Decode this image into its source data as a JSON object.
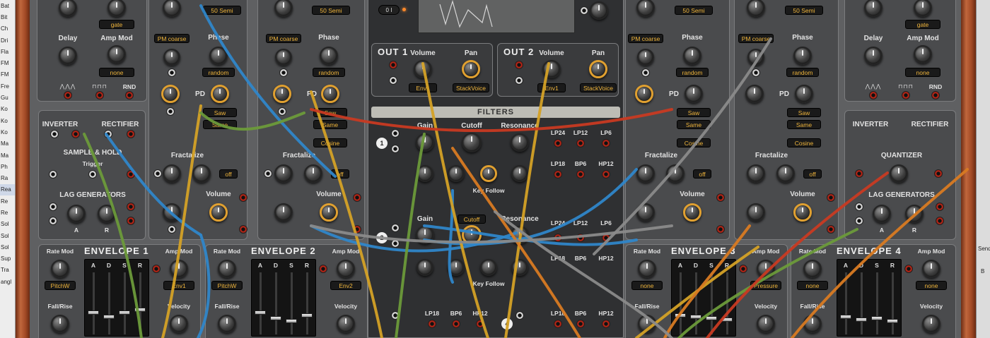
{
  "browser": {
    "items": [
      "Bat",
      "Bit",
      "Ch",
      "Dri",
      "Fla",
      "FM",
      "FM",
      "Fre",
      "Gu",
      "Ko",
      "Ko",
      "Ko",
      "Ma",
      "Ma",
      "Ph",
      "Ra",
      "Rea",
      "Re",
      "Re",
      "Sol",
      "Sol",
      "Sol",
      "Sup",
      "Tra",
      "angl"
    ],
    "selected_index": 16
  },
  "right_strip": {
    "top_text": "Send",
    "letter": "B"
  },
  "colors": {
    "rack": "#5f6062",
    "wood": "#a24a25",
    "accent": "#f0b53b",
    "cable_blue": "#2f86c9",
    "cable_yellow": "#d4a126",
    "cable_green": "#6b9a3a",
    "cable_orange": "#d87a22",
    "cable_red": "#c83a22",
    "cable_gray": "#8a8a8a"
  },
  "oscs": {
    "semi_display": "50 Semi",
    "pm_coarse": "PM coarse",
    "phase": "Phase",
    "random": "random",
    "pd": "PD",
    "saw": "Saw",
    "same": "Same",
    "cosine": "Cosine",
    "fractalize": "Fractalize",
    "off": "off",
    "volume": "Volume"
  },
  "lfo": {
    "delay": "Delay",
    "amp_mod": "Amp Mod",
    "gate": "gate",
    "none": "none",
    "rnd": "RND"
  },
  "util_left": {
    "inverter": "INVERTER",
    "rectifier": "RECTIFIER",
    "sample_hold": "SAMPLE & HOLD",
    "trigger": "Trigger",
    "lag_generators": "LAG GENERATORS",
    "a": "A",
    "r": "R"
  },
  "util_right": {
    "inverter": "INVERTER",
    "rectifier": "RECTIFIER",
    "quantizer": "QUANTIZER",
    "lag_generators": "LAG GENERATORS",
    "a": "A",
    "r": "R"
  },
  "center": {
    "toggle": "0 I",
    "out1": {
      "title": "OUT 1",
      "volume": "Volume",
      "pan": "Pan",
      "vol_src": "Env1",
      "pan_src": "StackVoice"
    },
    "out2": {
      "title": "OUT 2",
      "volume": "Volume",
      "pan": "Pan",
      "vol_src": "Env1",
      "pan_src": "StackVoice"
    },
    "filters": {
      "title": "FILTERS",
      "gain": "Gain",
      "cutoff": "Cutoff",
      "resonance": "Resonance",
      "key_follow": "Key Follow",
      "cutoff_display": "Cutoff",
      "lp24": "LP24",
      "lp12": "LP12",
      "lp6": "LP6",
      "lp18": "LP18",
      "bp6": "BP6",
      "hp12": "HP12",
      "nums": [
        "1",
        "2",
        "3",
        "4"
      ]
    }
  },
  "envelopes": [
    {
      "title": "ENVELOPE 1",
      "rate_mod": "Rate Mod",
      "amp_mod": "Amp Mod",
      "rate_src": "PitchW",
      "amp_src": "Env1",
      "fall_rise": "Fall/Rise",
      "velocity": "Velocity",
      "stages": [
        "A",
        "D",
        "S",
        "R"
      ]
    },
    {
      "title": "ENVELOPE 2",
      "rate_mod": "Rate Mod",
      "amp_mod": "Amp Mod",
      "rate_src": "PitchW",
      "amp_src": "Env2",
      "fall_rise": "Fall/Rise",
      "velocity": "Velocity",
      "stages": [
        "A",
        "D",
        "S",
        "R"
      ]
    },
    {
      "title": "ENVELOPE 3",
      "rate_mod": "Rate Mod",
      "amp_mod": "Amp Mod",
      "rate_src": "none",
      "amp_src": "Pressure",
      "fall_rise": "Fall/Rise",
      "velocity": "Velocity",
      "stages": [
        "A",
        "D",
        "S",
        "R"
      ]
    },
    {
      "title": "ENVELOPE 4",
      "rate_mod": "Rate Mod",
      "amp_mod": "Amp Mod",
      "rate_src": "none",
      "amp_src": "none",
      "fall_rise": "Fall/Rise",
      "velocity": "Velocity",
      "stages": [
        "A",
        "D",
        "S",
        "R"
      ]
    }
  ]
}
